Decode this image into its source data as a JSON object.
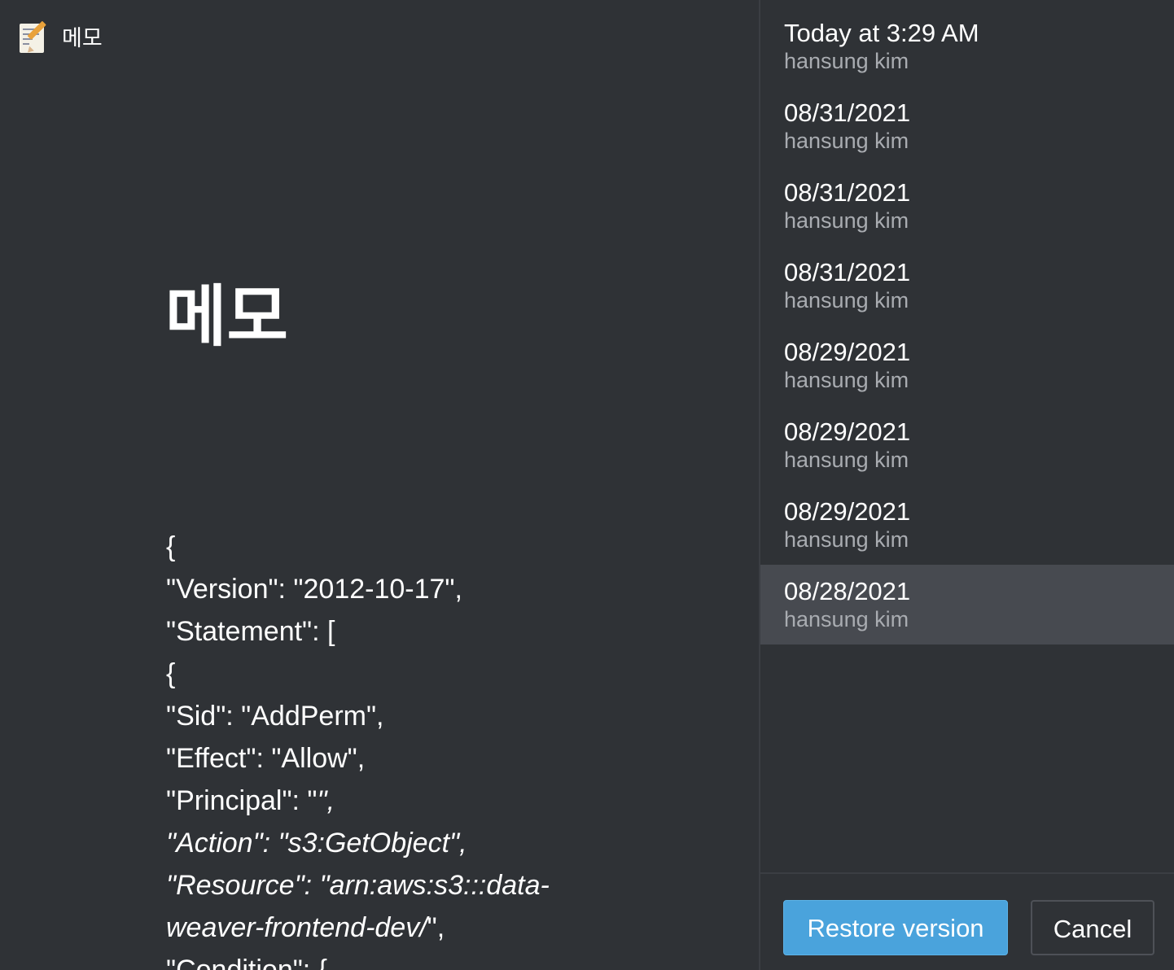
{
  "preview": {
    "breadcrumb": {
      "icon": "memo-icon",
      "label": "메모"
    },
    "title": "메모",
    "code_lines": [
      "{",
      "\"Version\": \"2012-10-17\",",
      "\"Statement\": [",
      "{",
      "\"Sid\": \"AddPerm\",",
      "\"Effect\": \"Allow\",",
      "\"Principal\": \"",
      "\",",
      "\"Action\": \"s3:GetObject\",",
      "\"Resource\": \"arn:aws:s3:::data-weaver-frontend-dev/",
      "\",",
      "\"Condition\": {"
    ]
  },
  "versions": {
    "items": [
      {
        "date": "Today at 3:29 AM",
        "author": "hansung kim",
        "selected": false
      },
      {
        "date": "08/31/2021",
        "author": "hansung kim",
        "selected": false
      },
      {
        "date": "08/31/2021",
        "author": "hansung kim",
        "selected": false
      },
      {
        "date": "08/31/2021",
        "author": "hansung kim",
        "selected": false
      },
      {
        "date": "08/29/2021",
        "author": "hansung kim",
        "selected": false
      },
      {
        "date": "08/29/2021",
        "author": "hansung kim",
        "selected": false
      },
      {
        "date": "08/29/2021",
        "author": "hansung kim",
        "selected": false
      },
      {
        "date": "08/28/2021",
        "author": "hansung kim",
        "selected": true
      }
    ]
  },
  "footer": {
    "restore_label": "Restore version",
    "cancel_label": "Cancel"
  },
  "colors": {
    "background": "#2f3236",
    "selected_row": "#474a50",
    "accent": "#4aa3dc",
    "muted_text": "#a9acb1"
  }
}
